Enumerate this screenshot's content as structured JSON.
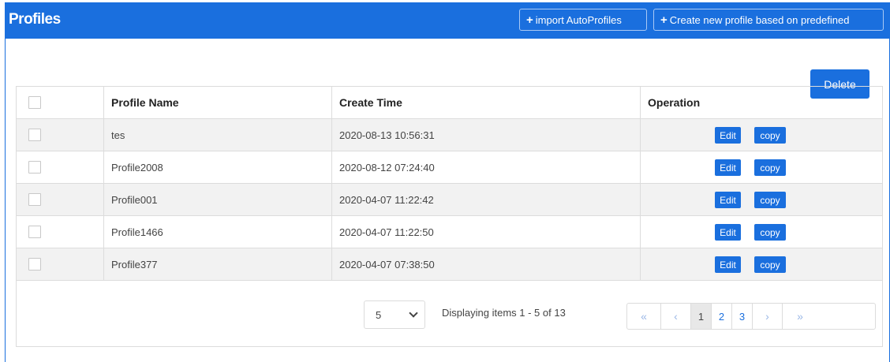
{
  "header": {
    "title": "Profiles",
    "import_label": "import AutoProfiles",
    "create_label": "Create new profile based on predefined",
    "plus_glyph": "+"
  },
  "toolbar": {
    "delete_label": "Delete"
  },
  "table": {
    "columns": [
      "Profile Name",
      "Create Time",
      "Operation"
    ],
    "rows": [
      {
        "name": "tes",
        "created": "2020-08-13 10:56:31"
      },
      {
        "name": "Profile2008",
        "created": "2020-08-12 07:24:40"
      },
      {
        "name": "Profile001",
        "created": "2020-04-07 11:22:42"
      },
      {
        "name": "Profile1466",
        "created": "2020-04-07 11:22:50"
      },
      {
        "name": "Profile377",
        "created": "2020-04-07 07:38:50"
      }
    ],
    "edit_label": "Edit",
    "copy_label": "copy"
  },
  "pagination": {
    "page_size": "5",
    "display_text": "Displaying items 1 - 5 of 13",
    "first": "«",
    "prev": "‹",
    "pages": [
      "1",
      "2",
      "3"
    ],
    "current_page": "1",
    "next": "›",
    "last": "»"
  },
  "colors": {
    "accent": "#1a6fde",
    "alt_row": "#f2f2f2",
    "border": "#dcdcdc"
  }
}
